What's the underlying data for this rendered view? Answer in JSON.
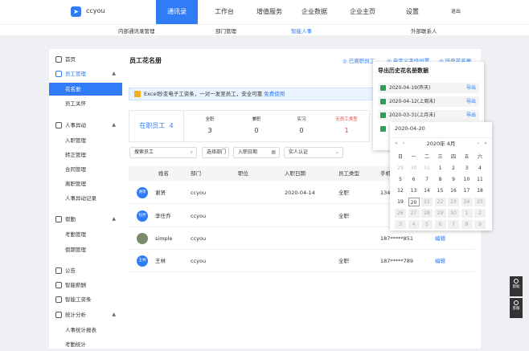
{
  "header": {
    "brand": "ccyou",
    "logo_icon": "paper-plane-icon",
    "nav": [
      "通讯录",
      "工作台",
      "增值服务",
      "企业数据",
      "企业主页",
      "设置"
    ],
    "logout": "退出"
  },
  "subnav": [
    "内部通讯录管理",
    "部门管理",
    "智能人事",
    "外部联系人"
  ],
  "sidebar": {
    "items": [
      {
        "label": "首页",
        "icon": "home-icon"
      },
      {
        "label": "员工管理",
        "icon": "user-icon"
      },
      {
        "label": "花名册"
      },
      {
        "label": "员工关怀"
      },
      {
        "label": "人事异动",
        "icon": "transfer-icon"
      },
      {
        "label": "入职管理"
      },
      {
        "label": "转正管理"
      },
      {
        "label": "合同管理"
      },
      {
        "label": "离职管理"
      },
      {
        "label": "人事异动记录"
      },
      {
        "label": "假勤",
        "icon": "clock-icon"
      },
      {
        "label": "考勤管理"
      },
      {
        "label": "假期管理"
      },
      {
        "label": "公告",
        "icon": "notice-icon"
      },
      {
        "label": "智能薪酬",
        "icon": "salary-icon"
      },
      {
        "label": "智能工资条",
        "icon": "payslip-icon"
      },
      {
        "label": "统计分析",
        "icon": "chart-icon"
      },
      {
        "label": "人事统计报表"
      },
      {
        "label": "考勤统计"
      }
    ]
  },
  "main": {
    "title": "员工花名册",
    "links": [
      "已离职员工",
      "自定义字段设置",
      "历史花名册"
    ],
    "banner_text": "Excel秒变电子工资条，一对一发至员工，安全可靠",
    "banner_link": "免费使用",
    "active_label": "在职员工",
    "active_count": "4",
    "stats": [
      {
        "label": "全职",
        "value": "3"
      },
      {
        "label": "兼职",
        "value": "0"
      },
      {
        "label": "实习",
        "value": "0"
      },
      {
        "label": "无员工类型",
        "value": "1"
      }
    ],
    "filters": {
      "search": "搜索员工",
      "dept": "选择部门",
      "date": "入职日期",
      "verify": "实人认证"
    },
    "columns": [
      "姓名",
      "部门",
      "职位",
      "入职日期",
      "员工类型",
      "手机"
    ],
    "rows": [
      {
        "avatar": "谢贤",
        "name": "谢贤",
        "dept": "ccyou",
        "pos": "",
        "date": "2020-04-14",
        "type": "全职",
        "phone": "134",
        "op": ""
      },
      {
        "avatar": "任乔",
        "name": "李任乔",
        "dept": "ccyou",
        "pos": "",
        "date": "",
        "type": "全职",
        "phone": "",
        "op": ""
      },
      {
        "avatar": "",
        "name": "simple",
        "dept": "ccyou",
        "pos": "",
        "date": "",
        "type": "",
        "phone": "187*****851",
        "op": "编辑"
      },
      {
        "avatar": "王林",
        "name": "王林",
        "dept": "ccyou",
        "pos": "",
        "date": "",
        "type": "全职",
        "phone": "187*****789",
        "op": "编辑"
      }
    ]
  },
  "export_popup": {
    "title": "导出历史花名册数据",
    "items": [
      {
        "date": "2020-04-19(昨天)",
        "action": "导出"
      },
      {
        "date": "2020-04-12(上周末)",
        "action": "导出"
      },
      {
        "date": "2020-03-31(上月末)",
        "action": "导出"
      }
    ]
  },
  "calendar": {
    "input": "2020-04-20",
    "month": "2020年 4月",
    "weekdays": [
      "日",
      "一",
      "二",
      "三",
      "四",
      "五",
      "六"
    ],
    "days": [
      [
        "29",
        "30",
        "31",
        "1",
        "2",
        "3",
        "4"
      ],
      [
        "5",
        "6",
        "7",
        "8",
        "9",
        "10",
        "11"
      ],
      [
        "12",
        "13",
        "14",
        "15",
        "16",
        "17",
        "18"
      ],
      [
        "19",
        "20",
        "21",
        "22",
        "23",
        "24",
        "25"
      ],
      [
        "26",
        "27",
        "28",
        "29",
        "30",
        "1",
        "2"
      ],
      [
        "3",
        "4",
        "5",
        "6",
        "7",
        "8",
        "9"
      ]
    ]
  },
  "floating": [
    "帮助",
    "客服"
  ]
}
